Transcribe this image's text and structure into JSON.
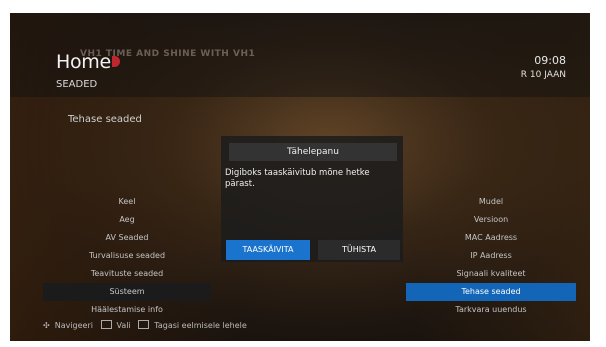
{
  "header": {
    "logo_text": "Home",
    "overlay_text": "VH1 TIME AND SHINE WITH VH1",
    "page_title": "SEADED",
    "time": "09:08",
    "date": "R 10 JAAN"
  },
  "subheading": "Tehase seaded",
  "left_menu": [
    "Keel",
    "Aeg",
    "AV Seaded",
    "Turvalisuse seaded",
    "Teavituste seaded",
    "Süsteem",
    "Häälestamise info"
  ],
  "right_menu": [
    "Mudel",
    "Versioon",
    "MAC Aadress",
    "IP Aadress",
    "Signaali kvaliteet",
    "Tehase seaded",
    "Tarkvara uuendus"
  ],
  "dialog": {
    "title": "Tähelepanu",
    "message": "Digiboks taaskäivitub mõne hetke pärast.",
    "confirm_label": "TAASKÄIVITA",
    "cancel_label": "TÜHISTA"
  },
  "footer": {
    "navigate": "Navigeeri",
    "select": "Vali",
    "back": "Tagasi eelmisele lehele"
  },
  "colors": {
    "selection": "#1265b7",
    "brand_red": "#c0262d"
  }
}
